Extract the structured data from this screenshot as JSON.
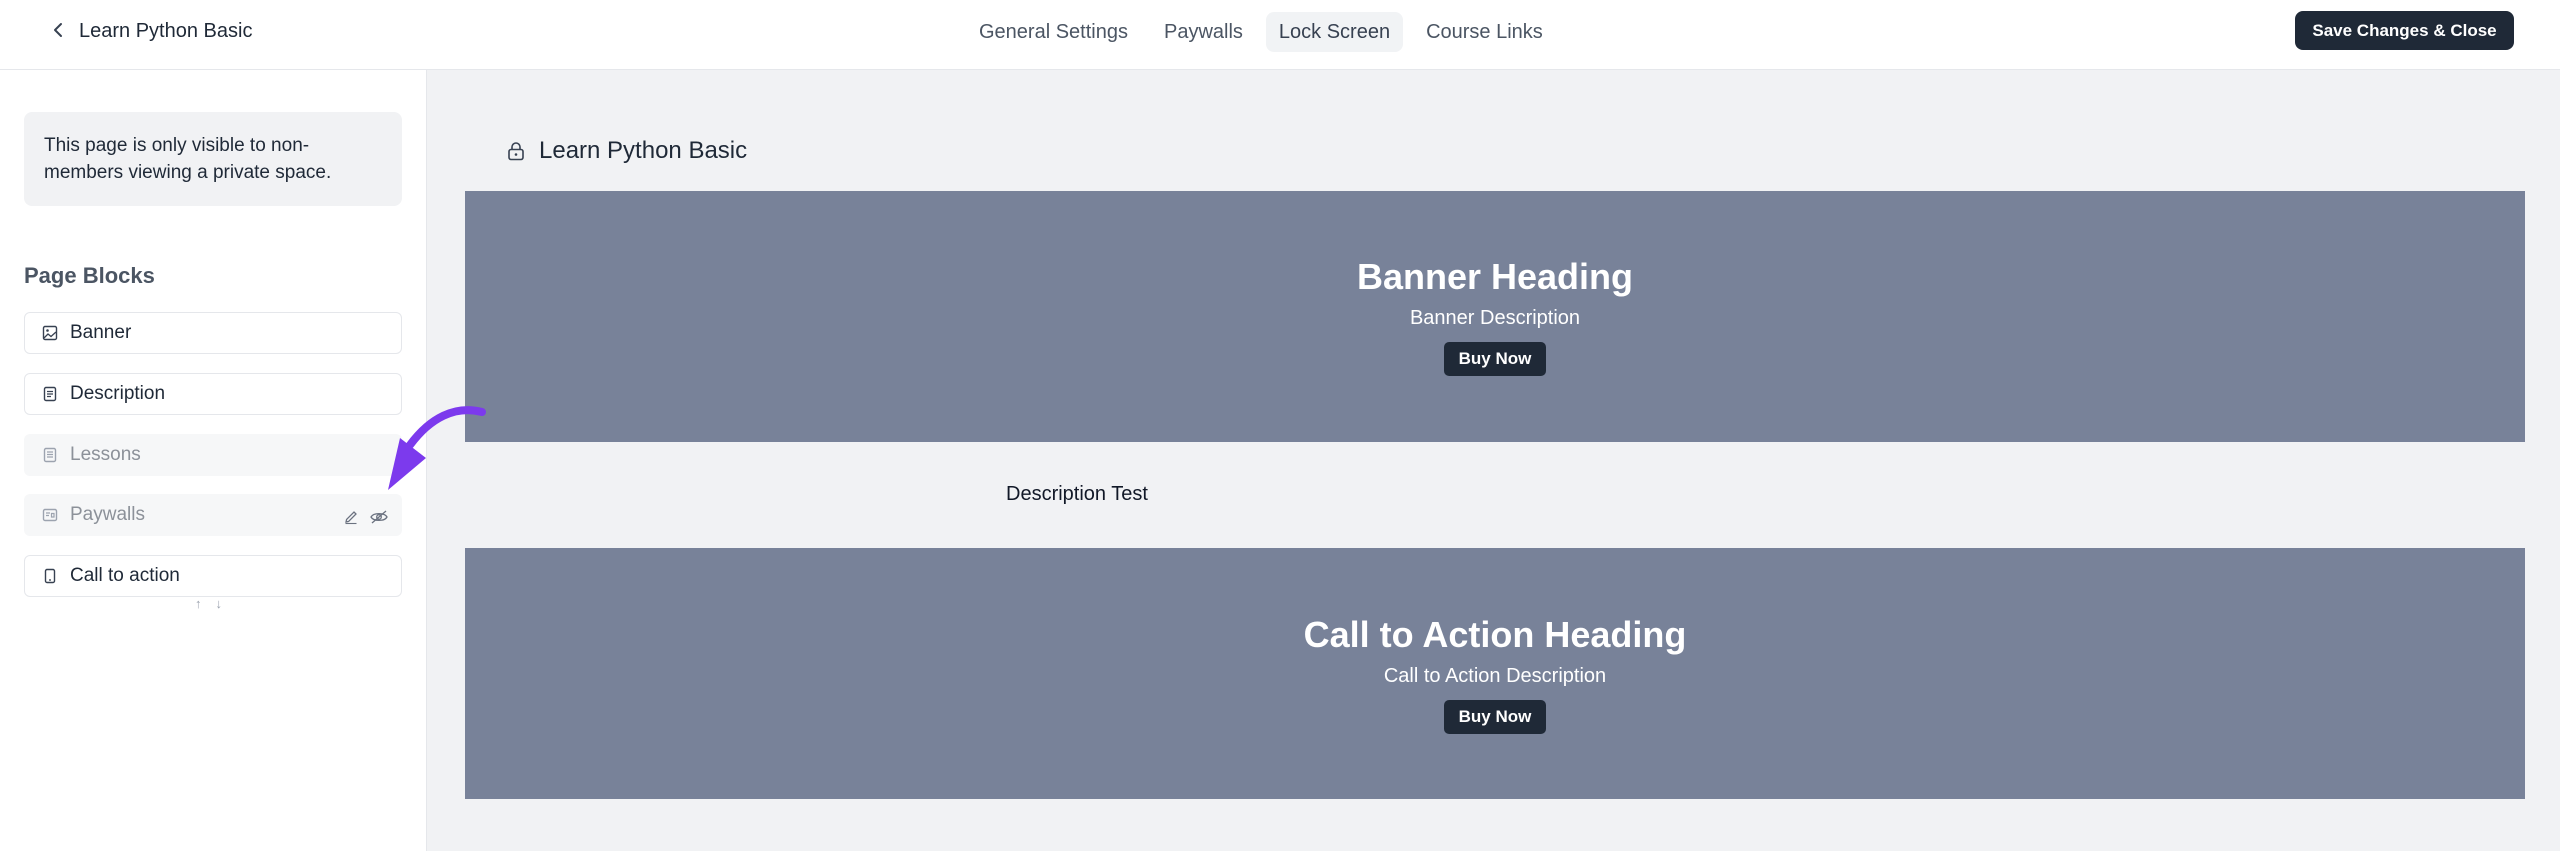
{
  "header": {
    "course_title": "Learn Python Basic",
    "tabs": [
      {
        "label": "General Settings"
      },
      {
        "label": "Paywalls"
      },
      {
        "label": "Lock Screen",
        "active": true
      },
      {
        "label": "Course Links"
      }
    ],
    "save_label": "Save Changes & Close"
  },
  "sidebar": {
    "notice": "This page is only visible to non-members viewing a private space.",
    "blocks_title": "Page Blocks",
    "blocks": [
      {
        "label": "Banner",
        "icon": "image-icon",
        "hidden": false
      },
      {
        "label": "Description",
        "icon": "document-icon",
        "hidden": false
      },
      {
        "label": "Lessons",
        "icon": "list-icon",
        "hidden": true
      },
      {
        "label": "Paywalls",
        "icon": "paywall-icon",
        "hidden": true
      },
      {
        "label": "Call to action",
        "icon": "mobile-icon",
        "hidden": false
      }
    ],
    "move_up": "↑",
    "move_down": "↓"
  },
  "preview": {
    "title": "Learn Python Basic",
    "banner": {
      "heading": "Banner Heading",
      "description": "Banner Description",
      "button": "Buy Now"
    },
    "description_text": "Description Test",
    "cta": {
      "heading": "Call to Action Heading",
      "description": "Call to Action Description",
      "button": "Buy Now"
    }
  },
  "colors": {
    "banner_bg": "#788299",
    "button_bg": "#1f2937",
    "annotation_arrow": "#7c3aed"
  }
}
